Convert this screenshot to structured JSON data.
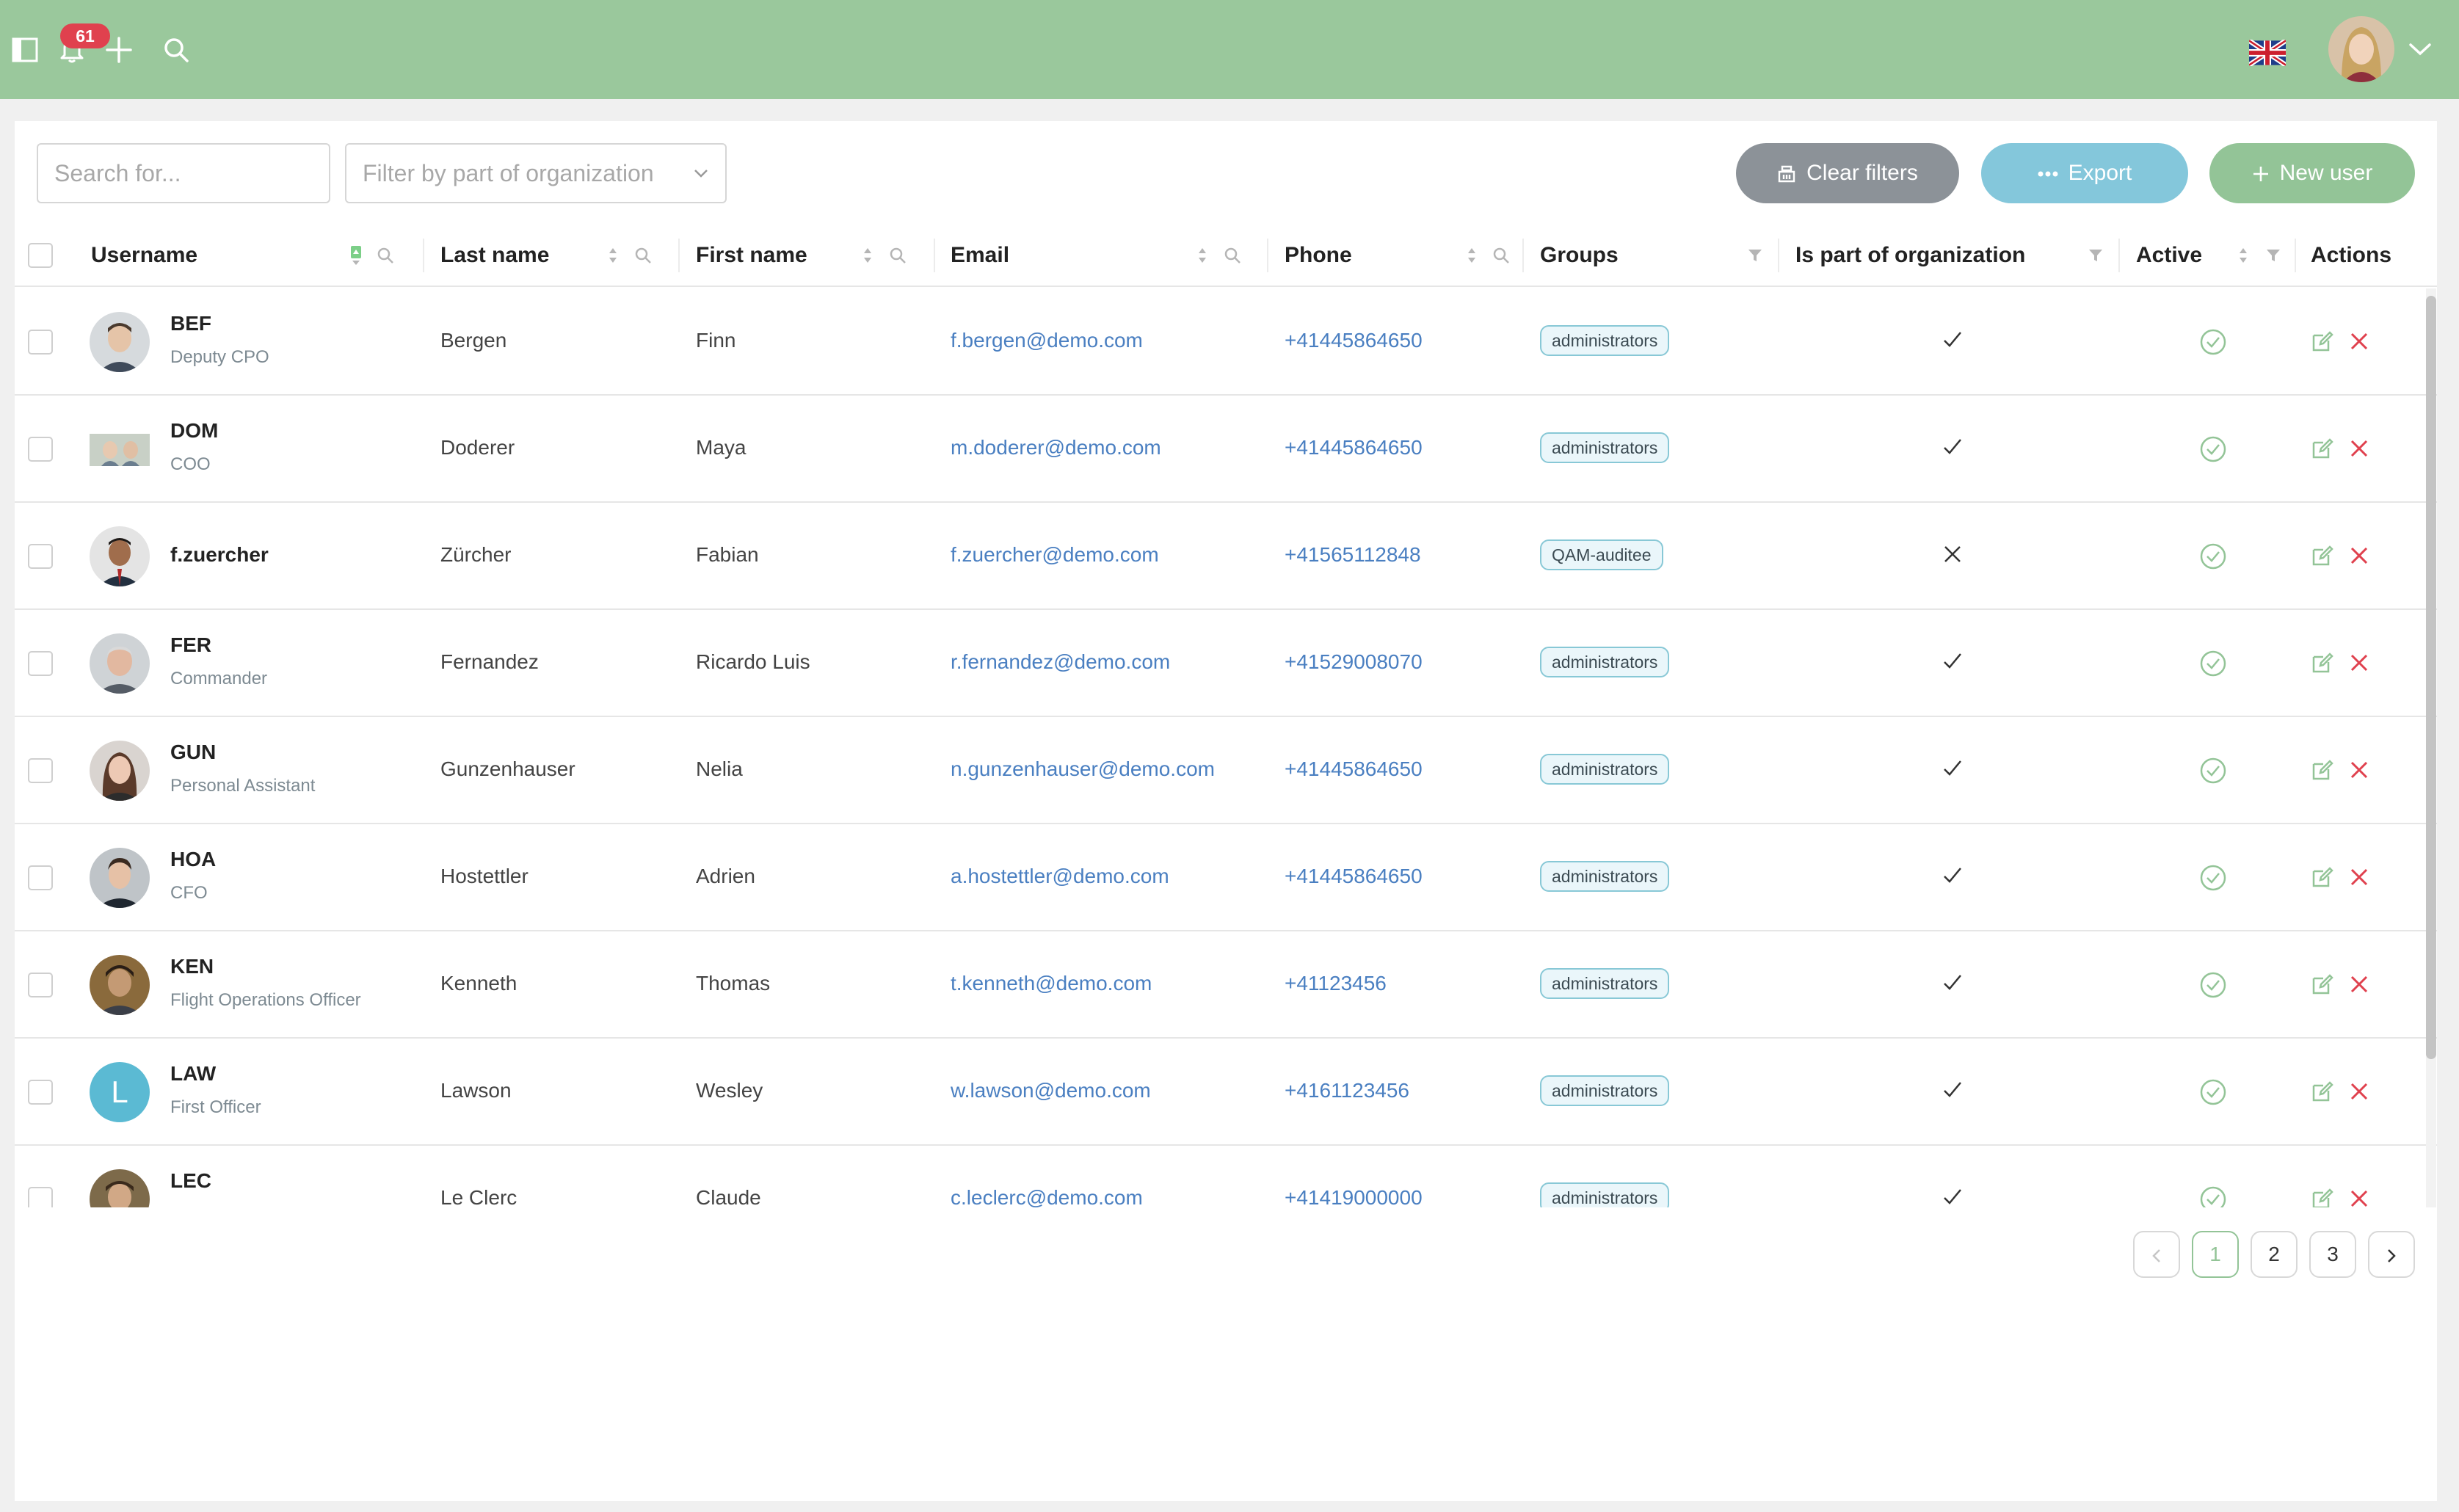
{
  "header": {
    "notification_count": "61"
  },
  "toolbar": {
    "search_placeholder": "Search for...",
    "org_filter_placeholder": "Filter by part of organization",
    "clear_filters_label": "Clear filters",
    "export_label": "Export",
    "new_user_label": "New user"
  },
  "table": {
    "columns": {
      "username": "Username",
      "last_name": "Last name",
      "first_name": "First name",
      "email": "Email",
      "phone": "Phone",
      "groups": "Groups",
      "is_part_of_org": "Is part of organization",
      "active": "Active",
      "actions": "Actions"
    },
    "rows": [
      {
        "username": "BEF",
        "title": "Deputy CPO",
        "last_name": "Bergen",
        "first_name": "Finn",
        "email": "f.bergen@demo.com",
        "phone": "+41445864650",
        "group": "administrators",
        "is_part_of_org": true,
        "active": true
      },
      {
        "username": "DOM",
        "title": "COO",
        "last_name": "Doderer",
        "first_name": "Maya",
        "email": "m.doderer@demo.com",
        "phone": "+41445864650",
        "group": "administrators",
        "is_part_of_org": true,
        "active": true
      },
      {
        "username": "f.zuercher",
        "title": "",
        "last_name": "Zürcher",
        "first_name": "Fabian",
        "email": "f.zuercher@demo.com",
        "phone": "+41565112848",
        "group": "QAM-auditee",
        "is_part_of_org": false,
        "active": true
      },
      {
        "username": "FER",
        "title": "Commander",
        "last_name": "Fernandez",
        "first_name": "Ricardo Luis",
        "email": "r.fernandez@demo.com",
        "phone": "+41529008070",
        "group": "administrators",
        "is_part_of_org": true,
        "active": true
      },
      {
        "username": "GUN",
        "title": "Personal Assistant",
        "last_name": "Gunzenhauser",
        "first_name": "Nelia",
        "email": "n.gunzenhauser@demo.com",
        "phone": "+41445864650",
        "group": "administrators",
        "is_part_of_org": true,
        "active": true
      },
      {
        "username": "HOA",
        "title": "CFO",
        "last_name": "Hostettler",
        "first_name": "Adrien",
        "email": "a.hostettler@demo.com",
        "phone": "+41445864650",
        "group": "administrators",
        "is_part_of_org": true,
        "active": true
      },
      {
        "username": "KEN",
        "title": "Flight Operations Officer",
        "last_name": "Kenneth",
        "first_name": "Thomas",
        "email": "t.kenneth@demo.com",
        "phone": "+41123456",
        "group": "administrators",
        "is_part_of_org": true,
        "active": true
      },
      {
        "username": "LAW",
        "title": "First Officer",
        "last_name": "Lawson",
        "first_name": "Wesley",
        "email": "w.lawson@demo.com",
        "phone": "+4161123456",
        "group": "administrators",
        "is_part_of_org": true,
        "active": true,
        "avatar_letter": "L"
      },
      {
        "username": "LEC",
        "title": "",
        "last_name": "Le Clerc",
        "first_name": "Claude",
        "email": "c.leclerc@demo.com",
        "phone": "+41419000000",
        "group": "administrators",
        "is_part_of_org": true,
        "active": true
      }
    ]
  },
  "pagination": {
    "pages": [
      "1",
      "2",
      "3"
    ],
    "current": "1"
  },
  "colors": {
    "header_bg": "#9ac89c",
    "accent_green": "#93c497",
    "export_blue": "#84c7db",
    "clear_gray": "#8c9298",
    "link_blue": "#4a7fc1",
    "delete_red": "#e0414e",
    "notification_red": "#e0414e"
  },
  "icons": {
    "sidebar_toggle": "sidebar-toggle-icon",
    "bell": "bell-icon",
    "plus": "plus-icon",
    "search": "search-icon",
    "flag": "uk-flag-icon",
    "edit": "edit-icon",
    "delete": "close-icon",
    "active": "check-circle-icon",
    "sort": "sort-icon",
    "filter": "filter-icon"
  }
}
